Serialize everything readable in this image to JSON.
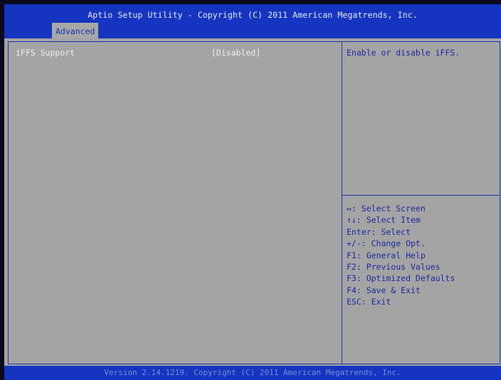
{
  "header": {
    "title": "Aptio Setup Utility - Copyright (C) 2011 American Megatrends, Inc.",
    "active_tab": "Advanced"
  },
  "settings": [
    {
      "name": "iFFS Support",
      "value": "[Disabled]"
    }
  ],
  "help": {
    "description": "Enable or disable iFFS.",
    "keys": [
      "↔: Select Screen",
      "↑↓: Select Item",
      "Enter: Select",
      "+/-: Change Opt.",
      "F1: General Help",
      "F2: Previous Values",
      "F3: Optimized Defaults",
      "F4: Save & Exit",
      "ESC: Exit"
    ]
  },
  "footer": {
    "text": "Version 2.14.1219. Copyright (C) 2011 American Megatrends, Inc."
  },
  "colors": {
    "header_bg": "#1535c0",
    "panel_bg": "#a4a4a4",
    "setting_text": "#f0f0f0",
    "help_text": "#1a2a9e"
  }
}
